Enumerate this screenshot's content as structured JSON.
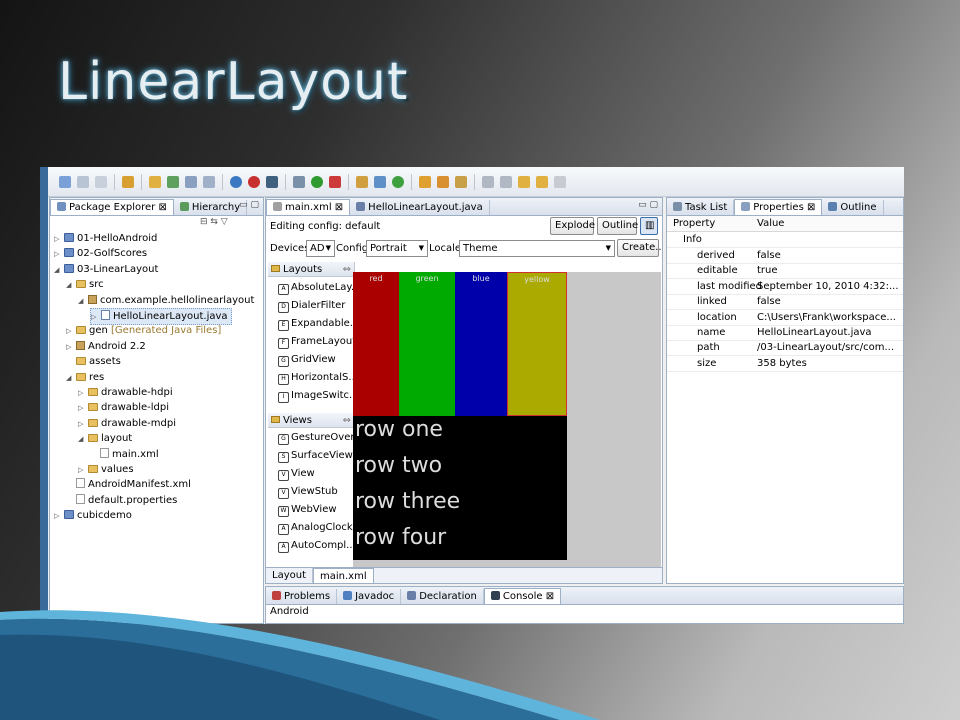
{
  "slide": {
    "title": "LinearLayout"
  },
  "package_explorer": {
    "tabs": [
      "Package Explorer",
      "Hierarchy"
    ],
    "tree": [
      {
        "label": "01-HelloAndroid",
        "indent": 0,
        "kind": "project",
        "tw": "▷"
      },
      {
        "label": "02-GolfScores",
        "indent": 0,
        "kind": "project",
        "tw": "▷"
      },
      {
        "label": "03-LinearLayout",
        "indent": 0,
        "kind": "project",
        "tw": "◢"
      },
      {
        "label": "src",
        "indent": 1,
        "kind": "folder",
        "tw": "◢"
      },
      {
        "label": "com.example.hellolinearlayout",
        "indent": 2,
        "kind": "package",
        "tw": "◢"
      },
      {
        "label": "HelloLinearLayout.java",
        "indent": 3,
        "kind": "java",
        "tw": "▷",
        "selected": true
      },
      {
        "label": "gen",
        "indent": 1,
        "kind": "folder",
        "tw": "▷",
        "suffix": "[Generated Java Files]"
      },
      {
        "label": "Android 2.2",
        "indent": 1,
        "kind": "lib",
        "tw": "▷"
      },
      {
        "label": "assets",
        "indent": 1,
        "kind": "folder",
        "tw": ""
      },
      {
        "label": "res",
        "indent": 1,
        "kind": "folder",
        "tw": "◢"
      },
      {
        "label": "drawable-hdpi",
        "indent": 2,
        "kind": "folder",
        "tw": "▷"
      },
      {
        "label": "drawable-ldpi",
        "indent": 2,
        "kind": "folder",
        "tw": "▷"
      },
      {
        "label": "drawable-mdpi",
        "indent": 2,
        "kind": "folder",
        "tw": "▷"
      },
      {
        "label": "layout",
        "indent": 2,
        "kind": "folder",
        "tw": "◢"
      },
      {
        "label": "main.xml",
        "indent": 3,
        "kind": "xml",
        "tw": ""
      },
      {
        "label": "values",
        "indent": 2,
        "kind": "folder",
        "tw": "▷"
      },
      {
        "label": "AndroidManifest.xml",
        "indent": 1,
        "kind": "xml",
        "tw": ""
      },
      {
        "label": "default.properties",
        "indent": 1,
        "kind": "file",
        "tw": ""
      },
      {
        "label": "cubicdemo",
        "indent": 0,
        "kind": "project",
        "tw": "▷"
      }
    ]
  },
  "editor": {
    "tabs": [
      "main.xml",
      "HelloLinearLayout.java"
    ],
    "editing_config": "Editing config: default",
    "buttons": {
      "explode": "Explode",
      "outline": "Outline",
      "create": "Create..."
    },
    "devices_label": "Devices",
    "devices_value": "AD",
    "config_label": "Config",
    "config_value": "Portrait",
    "locale_label": "Locale",
    "theme_value": "Theme",
    "palette": {
      "layouts_header": "Layouts",
      "layouts": [
        "AbsoluteLay...",
        "DialerFilter",
        "Expandable...",
        "FrameLayout",
        "GridView",
        "HorizontalS...",
        "ImageSwitc..."
      ],
      "views_header": "Views",
      "views": [
        "GestureOver...",
        "SurfaceView",
        "View",
        "ViewStub",
        "WebView",
        "AnalogClock",
        "AutoCompl..."
      ]
    },
    "preview": {
      "columns": [
        {
          "label": "red",
          "color": "#aa0000"
        },
        {
          "label": "green",
          "color": "#00aa00"
        },
        {
          "label": "blue",
          "color": "#0000aa"
        },
        {
          "label": "yellow",
          "color": "#aaaa00"
        }
      ],
      "rows": [
        "row one",
        "row two",
        "row three",
        "row four"
      ]
    },
    "bottom_tabs": [
      "Layout",
      "main.xml"
    ]
  },
  "right_panel": {
    "tabs": [
      "Task List",
      "Properties",
      "Outline"
    ],
    "columns": {
      "property": "Property",
      "value": "Value"
    },
    "group": "Info",
    "rows": [
      {
        "k": "derived",
        "v": "false"
      },
      {
        "k": "editable",
        "v": "true"
      },
      {
        "k": "last modified",
        "v": "September 10, 2010 4:32:..."
      },
      {
        "k": "linked",
        "v": "false"
      },
      {
        "k": "location",
        "v": "C:\\Users\\Frank\\workspace..."
      },
      {
        "k": "name",
        "v": "HelloLinearLayout.java"
      },
      {
        "k": "path",
        "v": "/03-LinearLayout/src/com..."
      },
      {
        "k": "size",
        "v": "358  bytes"
      }
    ]
  },
  "console": {
    "tabs": [
      "Problems",
      "Javadoc",
      "Declaration",
      "Console"
    ],
    "text": "Android"
  }
}
